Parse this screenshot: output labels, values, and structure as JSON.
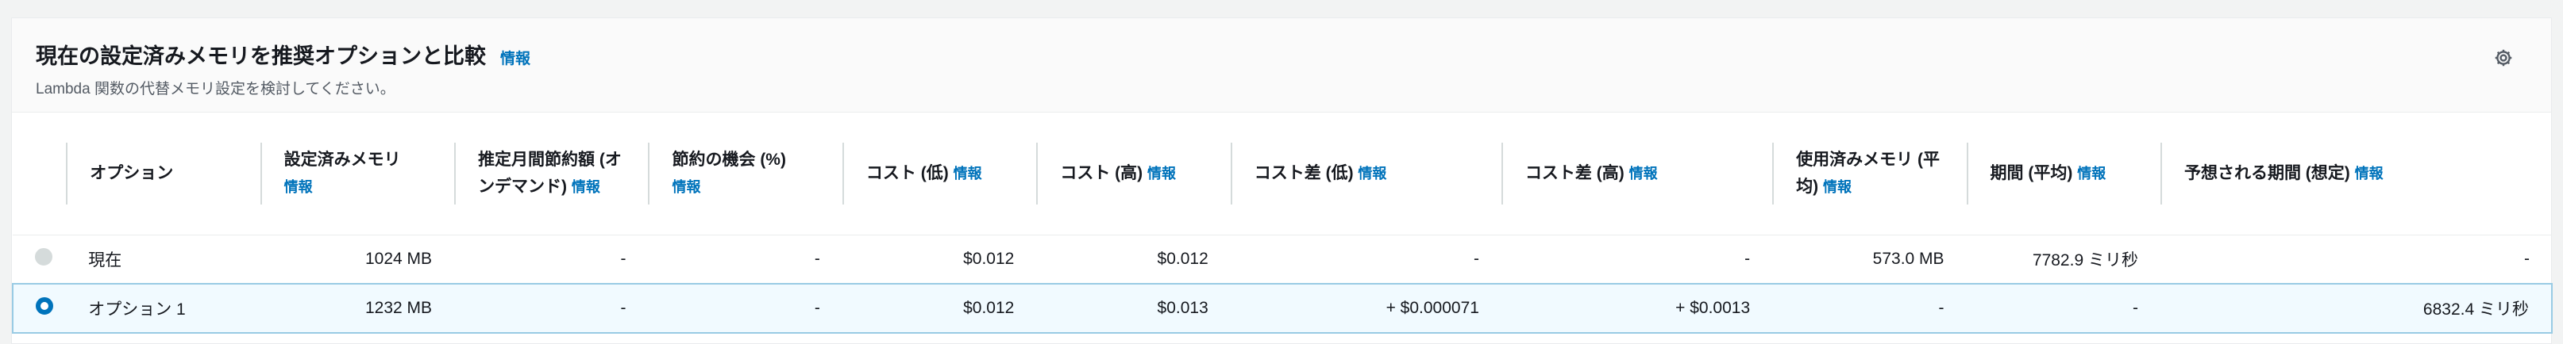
{
  "panel": {
    "title": "現在の設定済みメモリを推奨オプションと比較",
    "title_info": "情報",
    "subtitle": "Lambda 関数の代替メモリ設定を検討してください。"
  },
  "icons": {
    "settings": "gear-icon"
  },
  "table": {
    "headers": [
      {
        "label": "",
        "info": ""
      },
      {
        "label": "オプション",
        "info": ""
      },
      {
        "label": "設定済みメモリ",
        "info": "情報"
      },
      {
        "label": "推定月間節約額 (オンデマンド)",
        "info": "情報"
      },
      {
        "label": "節約の機会 (%)",
        "info": "情報"
      },
      {
        "label": "コスト (低)",
        "info": "情報"
      },
      {
        "label": "コスト (高)",
        "info": "情報"
      },
      {
        "label": "コスト差 (低)",
        "info": "情報"
      },
      {
        "label": "コスト差 (高)",
        "info": "情報"
      },
      {
        "label": "使用済みメモリ (平均)",
        "info": "情報"
      },
      {
        "label": "期間 (平均)",
        "info": "情報"
      },
      {
        "label": "予想される期間 (想定)",
        "info": "情報"
      }
    ],
    "rows": [
      {
        "selected": false,
        "cells": [
          "現在",
          "1024 MB",
          "-",
          "-",
          "$0.012",
          "$0.012",
          "-",
          "-",
          "573.0 MB",
          "7782.9 ミリ秒",
          "-"
        ]
      },
      {
        "selected": true,
        "cells": [
          "オプション 1",
          "1232 MB",
          "-",
          "-",
          "$0.012",
          "$0.013",
          "+ $0.000071",
          "+ $0.0013",
          "-",
          "-",
          "6832.4 ミリ秒"
        ]
      }
    ]
  }
}
